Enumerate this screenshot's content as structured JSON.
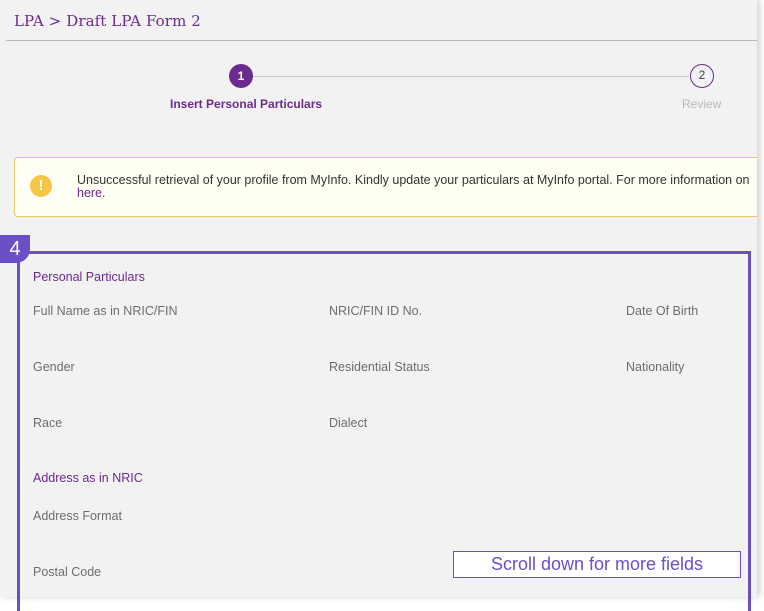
{
  "breadcrumb": "LPA > Draft LPA Form 2",
  "stepper": {
    "steps": [
      {
        "number": "1",
        "label": "Insert Personal Particulars"
      },
      {
        "number": "2",
        "label": "Review"
      }
    ]
  },
  "alert": {
    "icon": "exclamation-icon",
    "message": "Unsuccessful retrieval of your profile from MyInfo. Kindly update your particulars at MyInfo portal. For more information on",
    "link_text": "here."
  },
  "annotation": {
    "badge": "4",
    "note": "Scroll down for more fields"
  },
  "personal_particulars": {
    "title": "Personal Particulars",
    "fields": {
      "full_name": "Full Name as in NRIC/FIN",
      "nric": "NRIC/FIN ID No.",
      "dob": "Date Of Birth",
      "gender": "Gender",
      "residential_status": "Residential Status",
      "nationality": "Nationality",
      "race": "Race",
      "dialect": "Dialect"
    }
  },
  "address": {
    "title": "Address as in NRIC",
    "fields": {
      "address_format": "Address Format",
      "postal_code": "Postal Code"
    }
  }
}
